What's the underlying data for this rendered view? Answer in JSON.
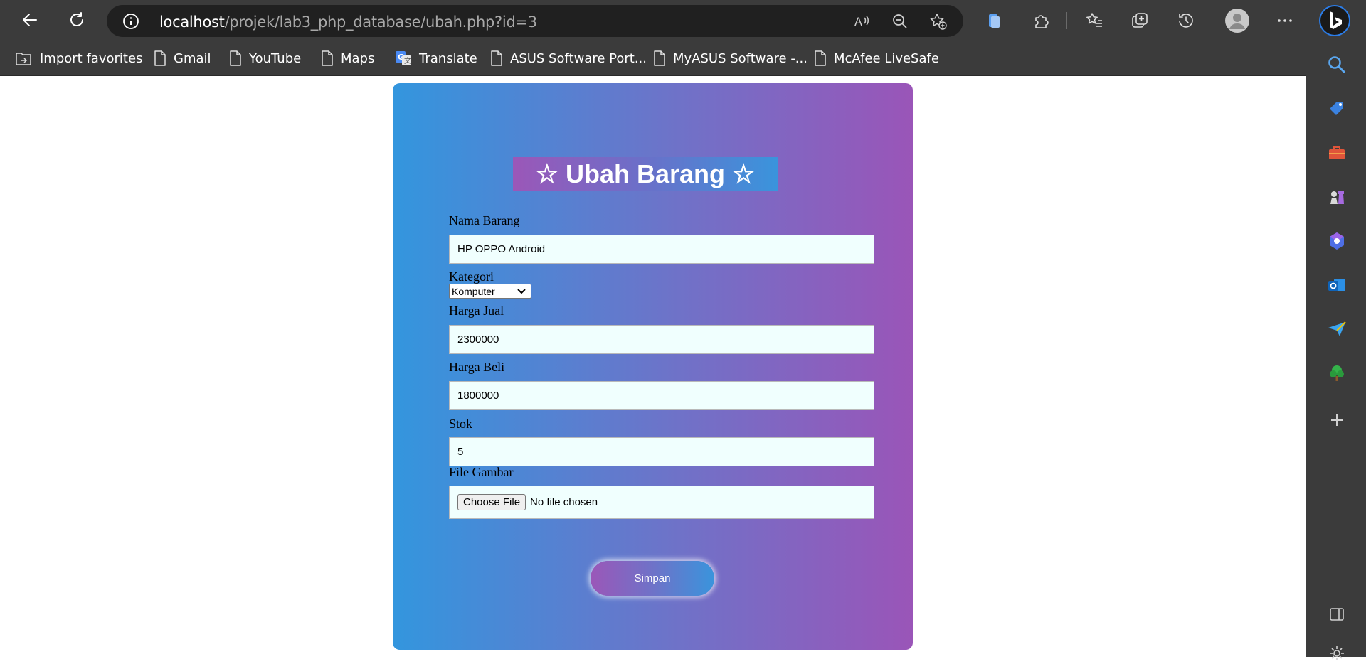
{
  "browser": {
    "url_host": "localhost",
    "url_path": "/projek/lab3_php_database/ubah.php?id=3"
  },
  "favorites": [
    {
      "label": "Import favorites",
      "icon": "import-icon"
    },
    {
      "label": "Gmail",
      "icon": "page-icon"
    },
    {
      "label": "YouTube",
      "icon": "page-icon"
    },
    {
      "label": "Maps",
      "icon": "page-icon"
    },
    {
      "label": "Translate",
      "icon": "translate-icon"
    },
    {
      "label": "ASUS Software Port...",
      "icon": "page-icon"
    },
    {
      "label": "MyASUS Software -...",
      "icon": "page-icon"
    },
    {
      "label": "McAfee LiveSafe",
      "icon": "page-icon"
    }
  ],
  "form": {
    "title": "☆ Ubah Barang ☆",
    "nama_label": "Nama Barang",
    "nama_value": "HP OPPO Android",
    "kategori_label": "Kategori",
    "kategori_value": "Komputer",
    "harga_jual_label": "Harga Jual",
    "harga_jual_value": "2300000",
    "harga_beli_label": "Harga Beli",
    "harga_beli_value": "1800000",
    "stok_label": "Stok",
    "stok_value": "5",
    "file_label": "File Gambar",
    "file_button": "Choose File",
    "file_status": "No file chosen",
    "submit_label": "Simpan"
  },
  "colors": {
    "card_gradient_start": "#3396de",
    "card_gradient_end": "#9a55b8",
    "input_bg": "#f0fffe",
    "chrome_bg": "#3b3b3b"
  }
}
